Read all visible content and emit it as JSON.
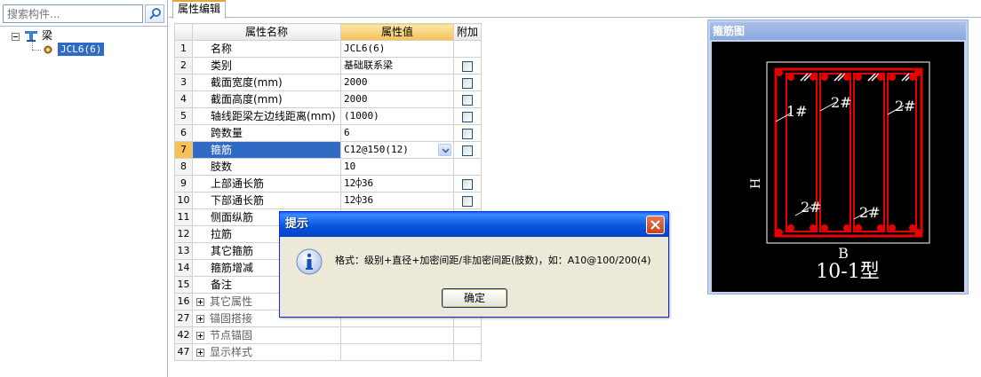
{
  "search": {
    "placeholder": "搜索构件..."
  },
  "tree": {
    "root_label": "梁",
    "child_label": "JCL6(6)"
  },
  "tabs": [
    {
      "label": "属性编辑"
    }
  ],
  "grid": {
    "headers": {
      "name": "属性名称",
      "value": "属性值",
      "extra": "附加"
    },
    "rows": [
      {
        "num": "1",
        "name": "名称",
        "value": "JCL6(6)",
        "checkbox": false,
        "selected": false
      },
      {
        "num": "2",
        "name": "类别",
        "value": "基础联系梁",
        "checkbox": true,
        "selected": false
      },
      {
        "num": "3",
        "name": "截面宽度(mm)",
        "value": "2000",
        "checkbox": true,
        "selected": false
      },
      {
        "num": "4",
        "name": "截面高度(mm)",
        "value": "2000",
        "checkbox": true,
        "selected": false
      },
      {
        "num": "5",
        "name": "轴线距梁左边线距离(mm)",
        "value": "(1000)",
        "checkbox": true,
        "selected": false
      },
      {
        "num": "6",
        "name": "跨数量",
        "value": "6",
        "checkbox": true,
        "selected": false
      },
      {
        "num": "7",
        "name": "箍筋",
        "value": "C12@150(12)",
        "checkbox": true,
        "selected": true
      },
      {
        "num": "8",
        "name": "肢数",
        "value": "10",
        "checkbox": false,
        "selected": false
      },
      {
        "num": "9",
        "name": "上部通长筋",
        "value": "12⌽36",
        "checkbox": true,
        "selected": false
      },
      {
        "num": "10",
        "name": "下部通长筋",
        "value": "12⌽36",
        "checkbox": true,
        "selected": false
      },
      {
        "num": "11",
        "name": "侧面纵筋",
        "value": "",
        "checkbox": false,
        "selected": false
      },
      {
        "num": "12",
        "name": "拉筋",
        "value": "",
        "checkbox": false,
        "selected": false
      },
      {
        "num": "13",
        "name": "其它箍筋",
        "value": "",
        "checkbox": false,
        "selected": false
      },
      {
        "num": "14",
        "name": "箍筋增减",
        "value": "",
        "checkbox": false,
        "selected": false
      },
      {
        "num": "15",
        "name": "备注",
        "value": "",
        "checkbox": false,
        "selected": false
      }
    ],
    "groups": [
      {
        "num": "16",
        "name": "其它属性"
      },
      {
        "num": "27",
        "name": "锚固搭接"
      },
      {
        "num": "42",
        "name": "节点锚固"
      },
      {
        "num": "47",
        "name": "显示样式"
      }
    ]
  },
  "rebar_panel": {
    "title": "箍筋图",
    "labels": {
      "l1": "1#",
      "l2a": "2#",
      "l2b": "2#",
      "l2c": "2#",
      "l2d": "2#",
      "h": "H",
      "b": "B",
      "type": "10-1型"
    }
  },
  "dialog": {
    "title": "提示",
    "message": "格式：级别+直径+加密间距/非加密间距(肢数)，如：A10@100/200(4)",
    "ok_label": "确定"
  }
}
